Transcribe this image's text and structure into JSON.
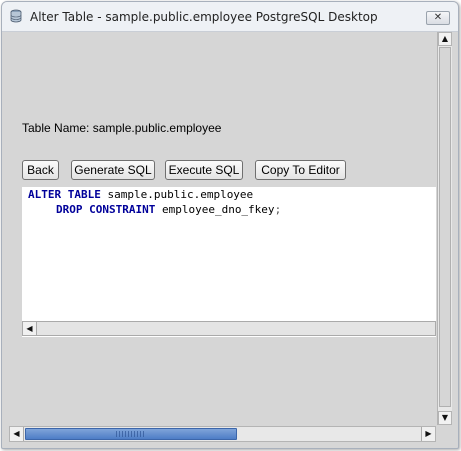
{
  "window": {
    "title": "Alter Table - sample.public.employee PostgreSQL Desktop",
    "close_symbol": "✕",
    "icon": "database-icon"
  },
  "form": {
    "table_name_label": "Table Name: sample.public.employee"
  },
  "buttons": {
    "back": "Back",
    "generate_sql": "Generate SQL",
    "execute_sql": "Execute SQL",
    "copy_to_editor": "Copy To Editor"
  },
  "sql": {
    "line1_kw": "ALTER TABLE",
    "line1_rest": " sample.public.employee",
    "line2_kw": "DROP CONSTRAINT",
    "line2_rest": " employee_dno_fkey",
    "line2_end": ";"
  },
  "scroll": {
    "left_arrow": "◀",
    "right_arrow": "▶",
    "up_arrow": "▲",
    "down_arrow": "▼"
  },
  "colors": {
    "keyword": "#00009a",
    "scroll_thumb": "#4e7dc6"
  }
}
